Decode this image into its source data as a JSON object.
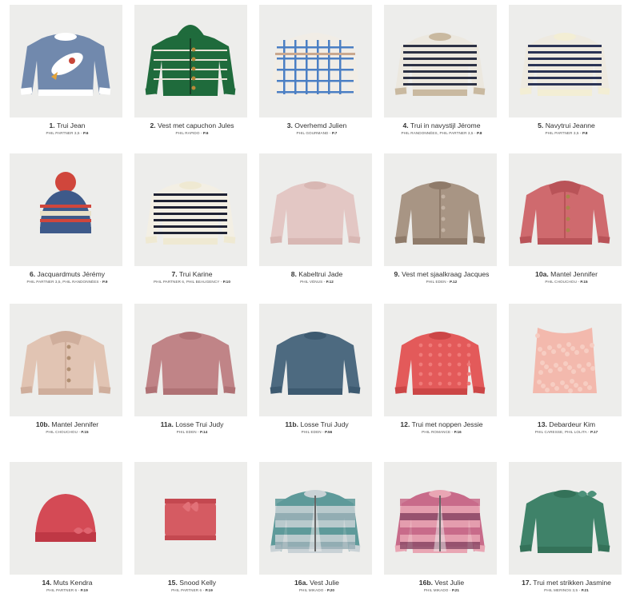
{
  "items": [
    {
      "num": "1.",
      "name": "Trui Jean",
      "yarn": "PHIL PARTNER 3,5",
      "page": "P.6",
      "garment": "sweater",
      "colors": [
        "#7189ad",
        "#ffffff",
        "#c8473a"
      ]
    },
    {
      "num": "2.",
      "name": "Vest met capuchon Jules",
      "yarn": "PHIL RAPIDO",
      "page": "P.6",
      "garment": "hoodie",
      "colors": [
        "#1f6b3c",
        "#e9e4d8",
        "#b88a3a"
      ]
    },
    {
      "num": "3.",
      "name": "Overhemd Julien",
      "yarn": "PHIL GOURMAND",
      "page": "P.7",
      "garment": "shirt",
      "colors": [
        "#f1ede6",
        "#4b7fc4",
        "#c9a88f"
      ]
    },
    {
      "num": "4.",
      "name": "Trui in navystijl Jérome",
      "yarn": "PHIL RANDONNÉES, PHIL PARTNER 3,5",
      "page": "P.8",
      "garment": "sweater-stripe",
      "colors": [
        "#ece8df",
        "#2c3144",
        "#c9b9a0"
      ]
    },
    {
      "num": "5.",
      "name": "Navytrui Jeanne",
      "yarn": "PHIL PARTNER 3,5",
      "page": "P.8",
      "garment": "sweater-stripe",
      "colors": [
        "#eeeae0",
        "#2a3355",
        "#f3eed4"
      ]
    },
    {
      "num": "6.",
      "name": "Jacquardmuts Jérémy",
      "yarn": "PHIL PARTNER 3,5, PHIL RANDONNÉES",
      "page": "P.9",
      "garment": "hat-pompom",
      "colors": [
        "#3e5a8a",
        "#d0463c",
        "#e8e0c8"
      ]
    },
    {
      "num": "7.",
      "name": "Trui Karine",
      "yarn": "PHIL PARTNER 6, PHIL BEAUGENCY",
      "page": "P.10",
      "garment": "sweater-stripe",
      "colors": [
        "#f3efe4",
        "#1f2233",
        "#efe9d2"
      ]
    },
    {
      "num": "8.",
      "name": "Kabeltrui Jade",
      "yarn": "PHIL VÉNUS",
      "page": "P.12",
      "garment": "sweater",
      "colors": [
        "#e3c7c4",
        "#d8b7b3",
        "#e3c7c4"
      ]
    },
    {
      "num": "9.",
      "name": "Vest met sjaalkraag Jacques",
      "yarn": "PHIL EDEN",
      "page": "P.12",
      "garment": "cardigan",
      "colors": [
        "#a89584",
        "#8f7b6a",
        "#c3b2a3"
      ]
    },
    {
      "num": "10a.",
      "name": "Mantel Jennifer",
      "yarn": "PHIL CHOUCHOU",
      "page": "P.15",
      "garment": "coat",
      "colors": [
        "#cf6a6e",
        "#b95358",
        "#a8864a"
      ]
    },
    {
      "num": "10b.",
      "name": "Mantel Jennifer",
      "yarn": "PHIL CHOUCHOU",
      "page": "P.15",
      "garment": "coat",
      "colors": [
        "#e1c4b3",
        "#cfae9c",
        "#b08f72"
      ]
    },
    {
      "num": "11a.",
      "name": "Losse Trui Judy",
      "yarn": "PHIL EDEN",
      "page": "P.14",
      "garment": "sweater",
      "colors": [
        "#c08487",
        "#b07275",
        "#c08487"
      ]
    },
    {
      "num": "11b.",
      "name": "Losse Trui Judy",
      "yarn": "PHIL EDEN",
      "page": "P.56",
      "garment": "sweater",
      "colors": [
        "#4d6a80",
        "#3d5a70",
        "#4d6a80"
      ]
    },
    {
      "num": "12.",
      "name": "Trui met noppen Jessie",
      "yarn": "PHIL ROMANCE",
      "page": "P.16",
      "garment": "sweater-dots",
      "colors": [
        "#e35a5a",
        "#cc4646",
        "#f07a78"
      ]
    },
    {
      "num": "13.",
      "name": "Debardeur Kim",
      "yarn": "PHIL CARESSE, PHIL LOLITA",
      "page": "P.17",
      "garment": "vest-top",
      "colors": [
        "#f3b9ad",
        "#f7cdc2",
        "#e7a597"
      ]
    },
    {
      "num": "14.",
      "name": "Muts Kendra",
      "yarn": "PHIL PARTNER 6",
      "page": "P.19",
      "garment": "hat-bow",
      "colors": [
        "#d44a55",
        "#bf3845",
        "#e06570"
      ]
    },
    {
      "num": "15.",
      "name": "Snood Kelly",
      "yarn": "PHIL PARTNER 6",
      "page": "P.19",
      "garment": "snood",
      "colors": [
        "#d55b62",
        "#c44850",
        "#e27178"
      ]
    },
    {
      "num": "16a.",
      "name": "Vest Julie",
      "yarn": "PHIL MIKADO",
      "page": "P.20",
      "garment": "cardigan-multi",
      "colors": [
        "#5e9a9a",
        "#c9d2d6",
        "#9bb0b7"
      ]
    },
    {
      "num": "16b.",
      "name": "Vest Julie",
      "yarn": "PHIL MIKADO",
      "page": "P.21",
      "garment": "cardigan-multi",
      "colors": [
        "#c86b8a",
        "#e9a6b4",
        "#8e4e6a"
      ]
    },
    {
      "num": "17.",
      "name": "Trui met strikken Jasmine",
      "yarn": "PHIL MERINOS 3,5",
      "page": "P.21",
      "garment": "sweater-bow",
      "colors": [
        "#3f8269",
        "#347259",
        "#4d917a"
      ]
    }
  ]
}
